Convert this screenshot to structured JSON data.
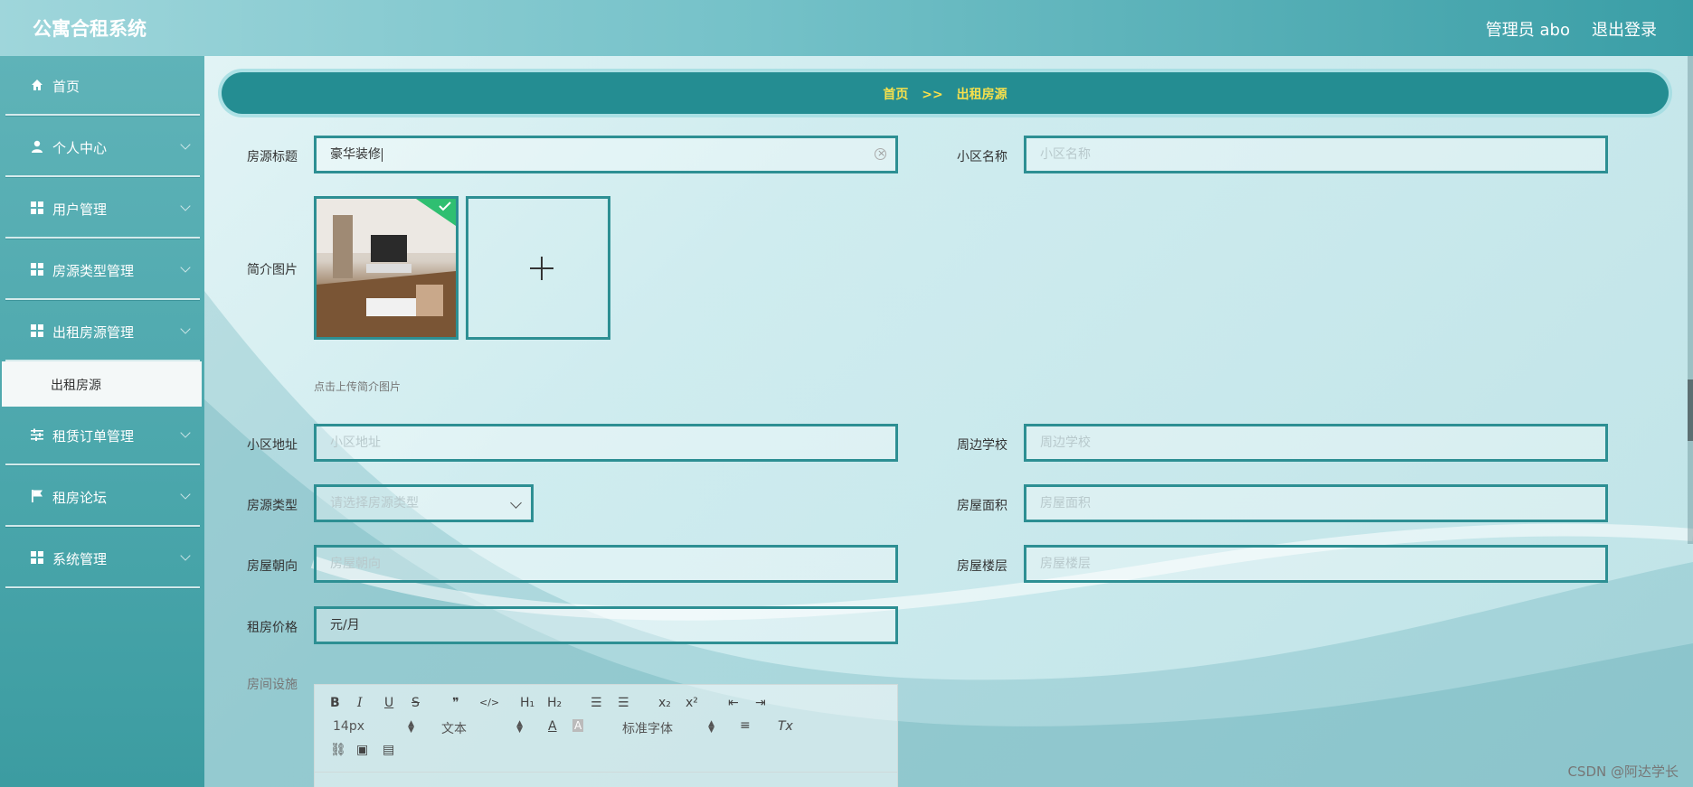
{
  "header": {
    "app_title": "公寓合租系统",
    "user_label": "管理员 abo",
    "logout_label": "退出登录"
  },
  "sidebar": {
    "items": [
      {
        "label": "首页",
        "icon": "home-icon"
      },
      {
        "label": "个人中心",
        "icon": "user-icon"
      },
      {
        "label": "用户管理",
        "icon": "grid-icon"
      },
      {
        "label": "房源类型管理",
        "icon": "grid-icon"
      },
      {
        "label": "出租房源管理",
        "icon": "grid-icon"
      },
      {
        "label": "租赁订单管理",
        "icon": "sliders-icon"
      },
      {
        "label": "租房论坛",
        "icon": "flag-icon"
      },
      {
        "label": "系统管理",
        "icon": "grid-icon"
      }
    ],
    "active_sub": "出租房源"
  },
  "breadcrumb": {
    "home": "首页",
    "sep": ">>",
    "current": "出租房源"
  },
  "form": {
    "title_label": "房源标题",
    "title_value": "豪华装修",
    "community_label": "小区名称",
    "community_placeholder": "小区名称",
    "image_label": "简介图片",
    "upload_tip": "点击上传简介图片",
    "address_label": "小区地址",
    "address_placeholder": "小区地址",
    "school_label": "周边学校",
    "school_placeholder": "周边学校",
    "type_label": "房源类型",
    "type_placeholder": "请选择房源类型",
    "area_label": "房屋面积",
    "area_placeholder": "房屋面积",
    "orientation_label": "房屋朝向",
    "orientation_placeholder": "房屋朝向",
    "floor_label": "房屋楼层",
    "floor_placeholder": "房屋楼层",
    "price_label": "租房价格",
    "price_value": "元/月",
    "facility_label": "房间设施"
  },
  "editor": {
    "bold": "B",
    "italic": "I",
    "underline": "U",
    "strike": "S",
    "quote": "❞",
    "code": "</>",
    "h1": "H₁",
    "h2": "H₂",
    "ordered": "☰",
    "bullet": "☰",
    "sub": "x₂",
    "sup": "x²",
    "outdent": "⇤",
    "indent": "⇥",
    "size": "14px",
    "text": "文本",
    "font": "标准字体",
    "clean": "Tx"
  },
  "watermark": "CSDN @阿达学长",
  "colors": {
    "accent": "#248d92",
    "crumb_text": "#f7e04c",
    "border": "#2d8f93"
  }
}
